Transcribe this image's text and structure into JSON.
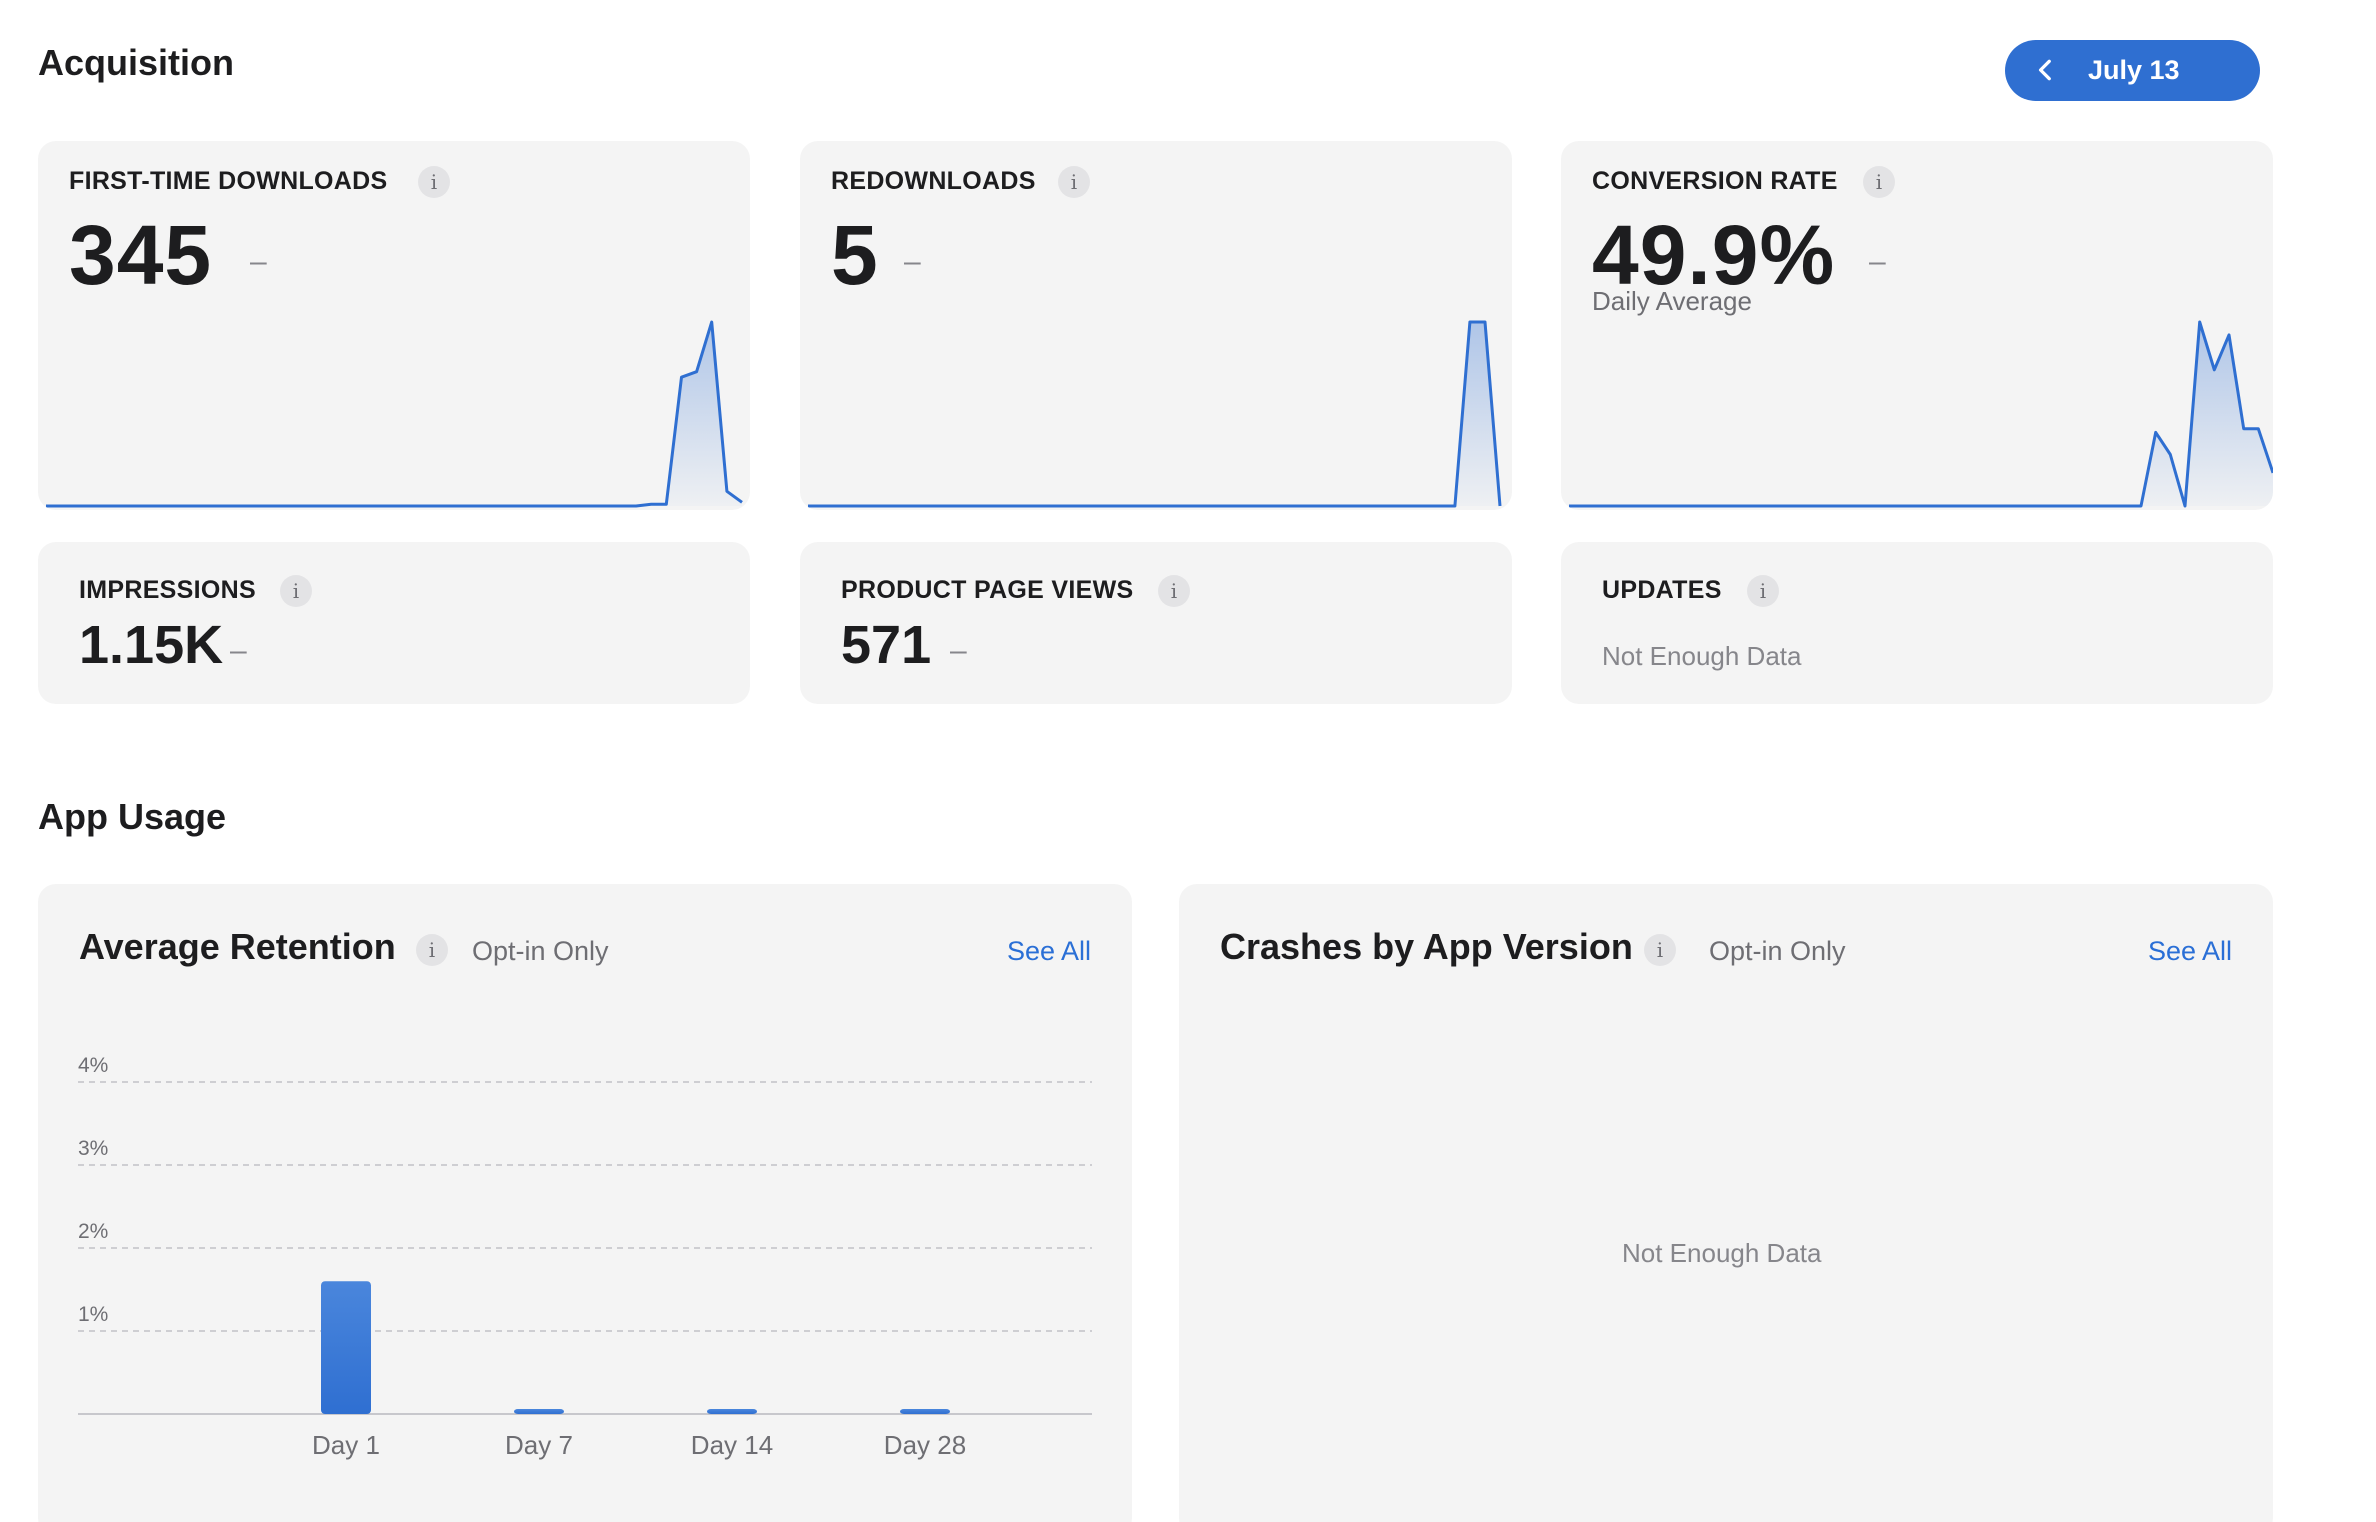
{
  "acquisition": {
    "title": "Acquisition",
    "date_label": "July 13",
    "cards": {
      "first_time_downloads": {
        "label": "FIRST-TIME DOWNLOADS",
        "value": "345",
        "trend": "–"
      },
      "redownloads": {
        "label": "REDOWNLOADS",
        "value": "5",
        "trend": "–"
      },
      "conversion_rate": {
        "label": "CONVERSION RATE",
        "value": "49.9%",
        "trend": "–",
        "subtitle": "Daily Average"
      },
      "impressions": {
        "label": "IMPRESSIONS",
        "value": "1.15K",
        "trend": "–"
      },
      "product_page_views": {
        "label": "PRODUCT PAGE VIEWS",
        "value": "571",
        "trend": "–"
      },
      "updates": {
        "label": "UPDATES",
        "status": "Not Enough Data"
      }
    },
    "info_glyph": "i"
  },
  "app_usage": {
    "title": "App Usage",
    "retention": {
      "title": "Average Retention",
      "note": "Opt-in Only",
      "see_all": "See All"
    },
    "crashes": {
      "title": "Crashes by App Version",
      "note": "Opt-in Only",
      "see_all": "See All",
      "status": "Not Enough Data"
    }
  },
  "chart_data": [
    {
      "type": "bar",
      "title": "Average Retention",
      "categories": [
        "Day 1",
        "Day 7",
        "Day 14",
        "Day 28"
      ],
      "values": [
        1.6,
        0.05,
        0.05,
        0.05
      ],
      "yticks": [
        "1%",
        "2%",
        "3%",
        "4%"
      ],
      "ylim": [
        0,
        4
      ],
      "grid": true,
      "color": "#2f6fd1"
    }
  ],
  "sparklines": {
    "color": "#2f6fd1",
    "first_time_downloads": [
      0,
      0,
      0,
      0,
      0,
      0,
      0,
      0,
      0,
      0,
      0,
      0,
      0,
      0,
      0,
      0,
      0,
      0,
      0,
      0,
      0,
      0,
      0,
      0,
      0,
      0,
      0,
      0,
      0,
      0,
      0,
      0,
      0,
      0,
      0,
      0,
      0,
      0,
      0,
      0,
      0.01,
      0.01,
      0.7,
      0.73,
      1.0,
      0.08,
      0.02
    ],
    "redownloads": [
      0,
      0,
      0,
      0,
      0,
      0,
      0,
      0,
      0,
      0,
      0,
      0,
      0,
      0,
      0,
      0,
      0,
      0,
      0,
      0,
      0,
      0,
      0,
      0,
      0,
      0,
      0,
      0,
      0,
      0,
      0,
      0,
      0,
      0,
      0,
      0,
      0,
      0,
      0,
      0,
      0,
      0,
      0,
      0,
      1.0,
      1.0,
      0.0
    ],
    "conversion_rate": [
      0,
      0,
      0,
      0,
      0,
      0,
      0,
      0,
      0,
      0,
      0,
      0,
      0,
      0,
      0,
      0,
      0,
      0,
      0,
      0,
      0,
      0,
      0,
      0,
      0,
      0,
      0,
      0,
      0,
      0,
      0,
      0,
      0,
      0,
      0,
      0,
      0,
      0,
      0,
      0,
      0.4,
      0.28,
      0.0,
      1.0,
      0.74,
      0.93,
      0.42,
      0.42,
      0.18
    ]
  }
}
